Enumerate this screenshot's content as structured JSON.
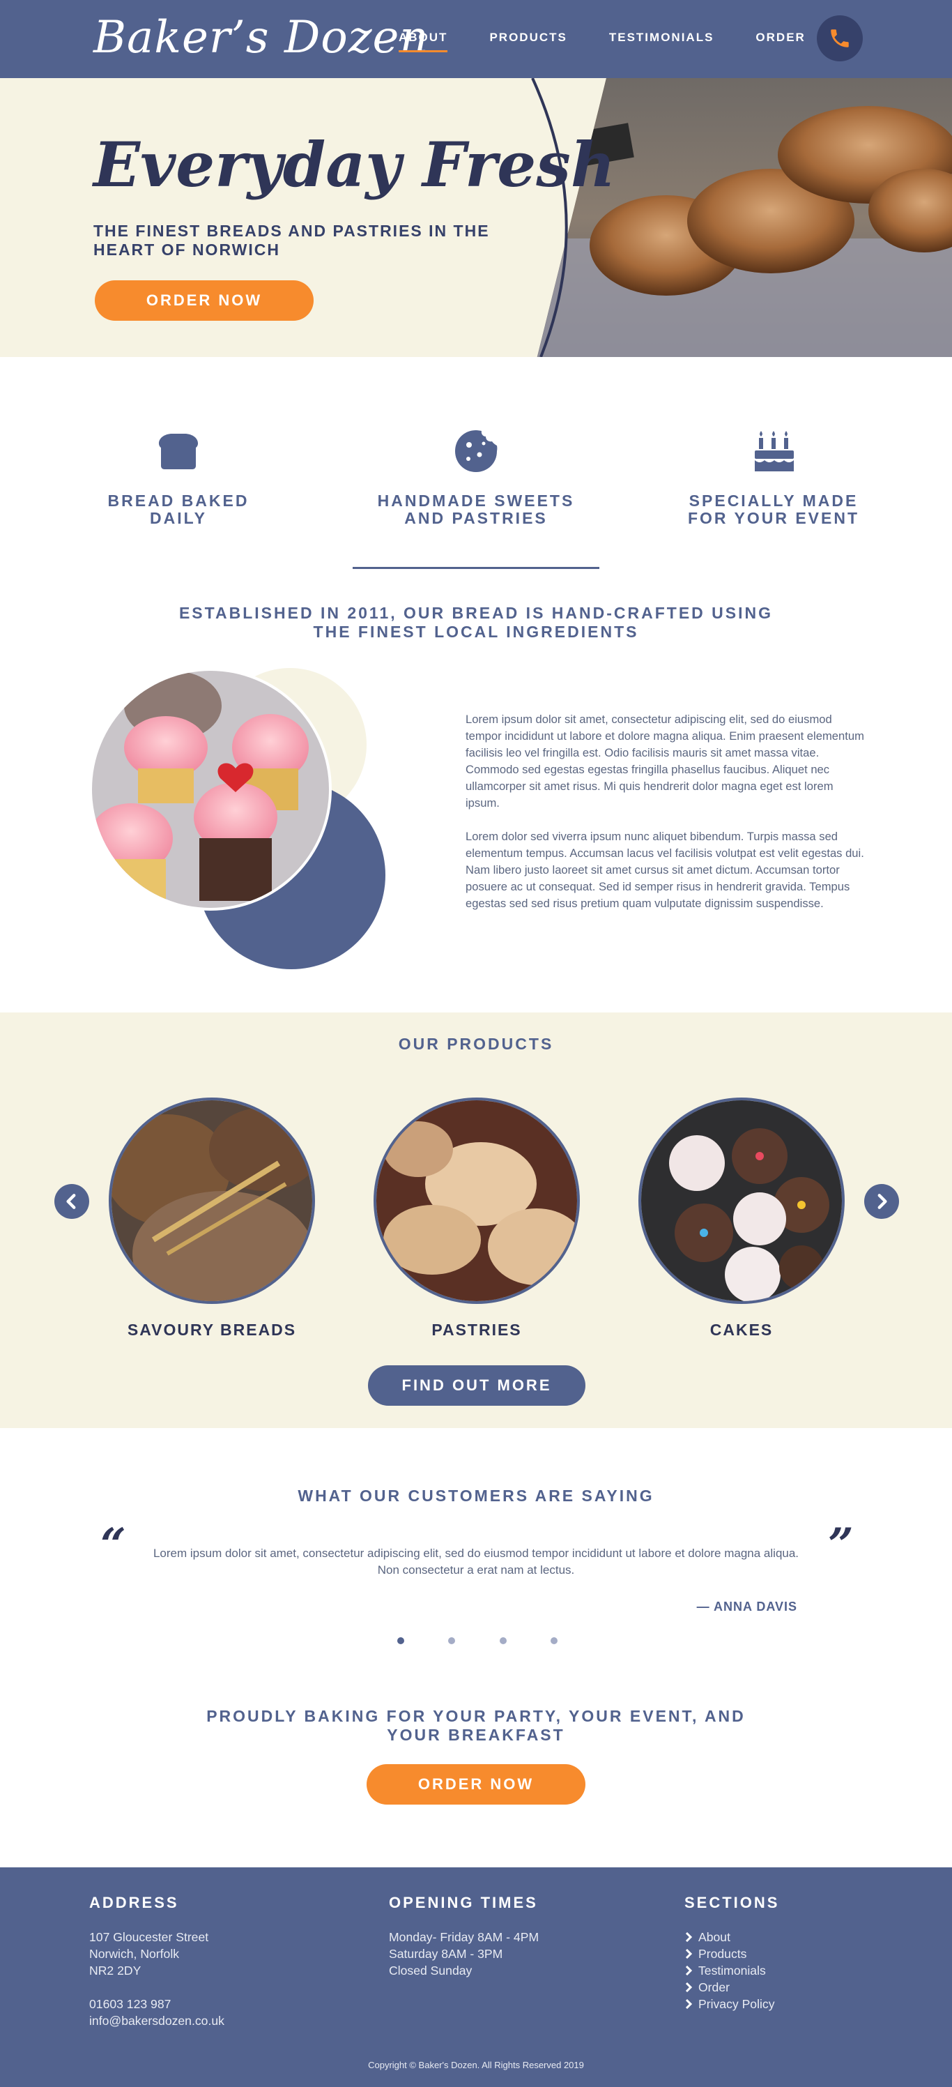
{
  "nav": {
    "logo": "Baker’s Dozen",
    "links": [
      {
        "label": "ABOUT",
        "active": true
      },
      {
        "label": "PRODUCTS",
        "active": false
      },
      {
        "label": "TESTIMONIALS",
        "active": false
      },
      {
        "label": "ORDER",
        "active": false
      }
    ],
    "phone_icon": "phone-icon"
  },
  "hero": {
    "title": "Everyday Fresh",
    "subtitle": "THE FINEST BREADS AND PASTRIES IN THE HEART OF NORWICH",
    "button": "ORDER NOW"
  },
  "features": [
    {
      "label": "BREAD BAKED\nDAILY",
      "icon": "bread-icon"
    },
    {
      "label": "HANDMADE SWEETS\nAND PASTRIES",
      "icon": "cookie-icon"
    },
    {
      "label": "SPECIALLY MADE\nFOR YOUR EVENT",
      "icon": "cake-icon"
    }
  ],
  "about": {
    "heading": "ESTABLISHED IN 2011, OUR BREAD IS HAND-CRAFTED USING\nTHE FINEST LOCAL INGREDIENTS",
    "paragraphs": [
      "Lorem ipsum dolor sit amet, consectetur adipiscing elit, sed do eiusmod tempor incididunt ut labore et dolore magna aliqua. Enim praesent elementum facilisis leo vel fringilla est. Odio facilisis mauris sit amet massa vitae. Commodo sed egestas egestas fringilla phasellus faucibus. Aliquet nec ullamcorper sit amet risus. Mi quis hendrerit dolor magna eget est lorem ipsum.",
      "Lorem dolor sed viverra ipsum nunc aliquet bibendum. Turpis massa sed elementum tempus. Accumsan lacus vel facilisis volutpat est velit egestas dui. Nam libero justo laoreet sit amet cursus sit amet dictum. Accumsan tortor posuere ac ut consequat. Sed id semper risus in hendrerit gravida. Tempus egestas sed sed risus pretium quam vulputate dignissim suspendisse."
    ]
  },
  "products": {
    "title": "OUR PRODUCTS",
    "items": [
      {
        "label": "SAVOURY BREADS"
      },
      {
        "label": "PASTRIES"
      },
      {
        "label": "CAKES"
      }
    ],
    "button": "FIND OUT MORE"
  },
  "testimonials": {
    "title": "WHAT OUR CUSTOMERS ARE SAYING",
    "open_quote": "“",
    "close_quote": "”",
    "text": "Lorem ipsum dolor sit amet, consectetur adipiscing elit, sed do eiusmod tempor incididunt ut labore et dolore magna aliqua. Non consectetur a erat nam at lectus.",
    "author": "— ANNA DAVIS",
    "dot_count": 4,
    "active_dot": 0
  },
  "cta": {
    "text": "PROUDLY BAKING FOR YOUR PARTY, YOUR EVENT, AND\nYOUR BREAKFAST",
    "button": "ORDER NOW"
  },
  "footer": {
    "address": {
      "heading": "ADDRESS",
      "lines": [
        "107 Gloucester Street",
        "Norwich, Norfolk",
        "NR2 2DY"
      ],
      "phone": "01603 123 987",
      "email": "info@bakersdozen.co.uk"
    },
    "hours": {
      "heading": "OPENING TIMES",
      "lines": [
        "Monday- Friday 8AM - 4PM",
        "Saturday 8AM - 3PM",
        "Closed Sunday"
      ]
    },
    "sections": {
      "heading": "SECTIONS",
      "links": [
        "About",
        "Products",
        "Testimonials",
        "Order",
        "Privacy Policy"
      ]
    },
    "copyright": "Copyright © Baker's Dozen. All Rights Reserved 2019"
  },
  "colors": {
    "navy": "#52628e",
    "dark_navy": "#2f3557",
    "cream": "#f6f3e3",
    "orange": "#f78b2d"
  }
}
